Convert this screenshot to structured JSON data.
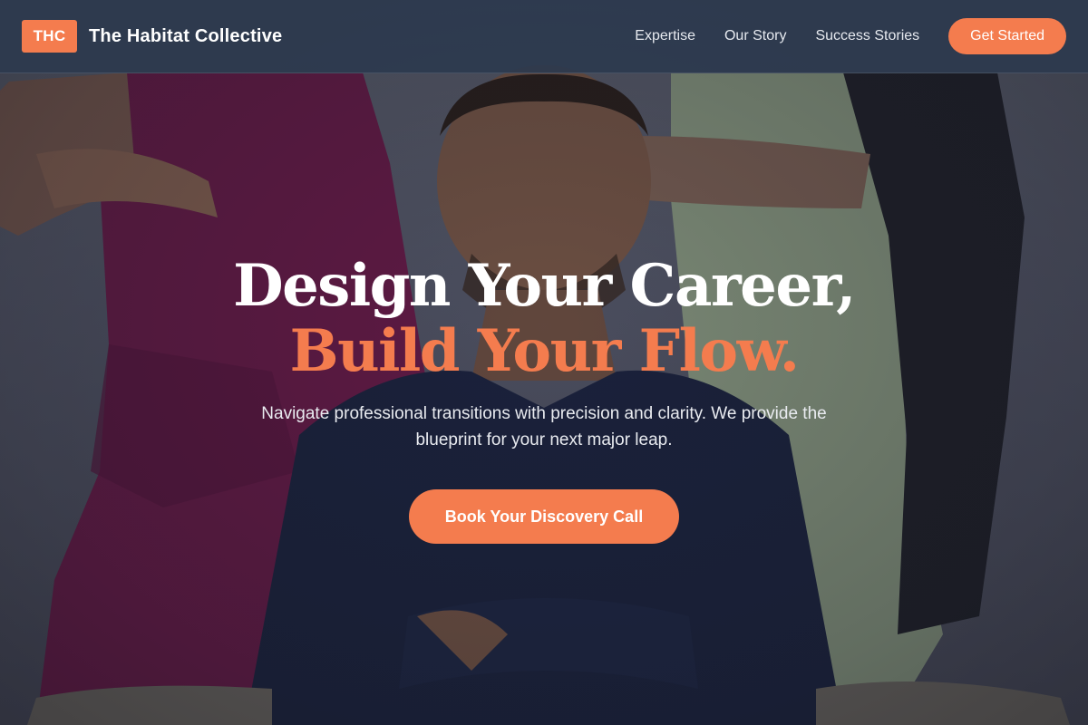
{
  "navbar": {
    "logo_text": "THC",
    "brand_name": "The Habitat Collective",
    "links": [
      "Expertise",
      "Our Story",
      "Success Stories"
    ],
    "cta_label": "Get Started"
  },
  "hero": {
    "headline_line1": "Design Your Career,",
    "headline_line2": "Build Your Flow.",
    "subtext": "Navigate professional transitions with precision and clarity. We provide the blueprint for your next major leap.",
    "cta_label": "Book Your Discovery Call",
    "background": "photo of three people standing, man in navy shirt seated in front"
  },
  "colors": {
    "accent": "#f47c4e",
    "navbar_bg": "#2c3a4e",
    "text_light": "#ffffff"
  }
}
